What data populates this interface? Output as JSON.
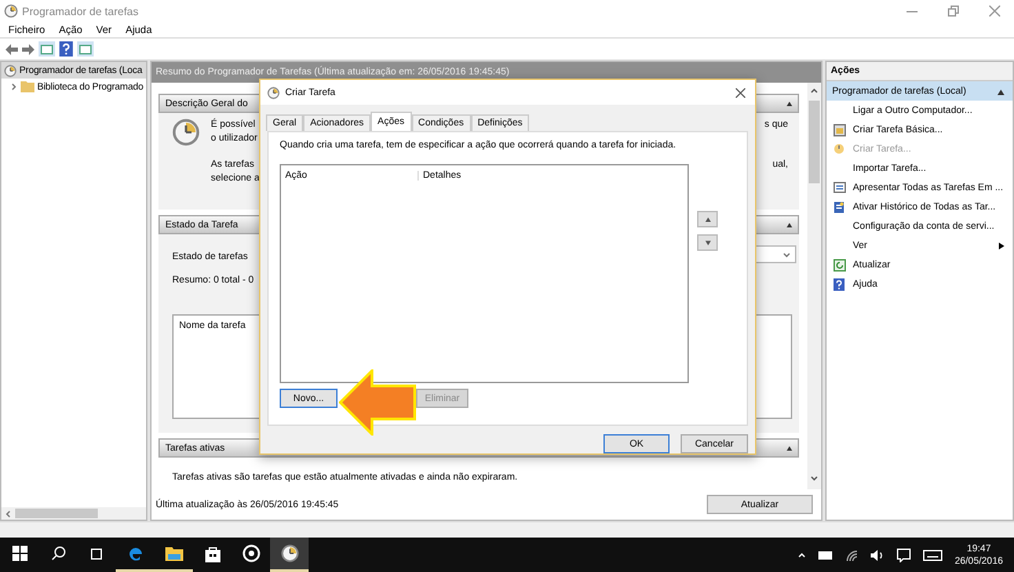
{
  "window": {
    "title": "Programador de tarefas"
  },
  "menu": [
    "Ficheiro",
    "Ação",
    "Ver",
    "Ajuda"
  ],
  "tree": [
    {
      "label": "Programador de tarefas (Loca",
      "selected": true,
      "expanded": true,
      "children": [
        {
          "label": "Biblioteca do Programado",
          "selected": false,
          "expanded": false
        }
      ]
    }
  ],
  "center": {
    "header": "Resumo do Programador de Tarefas (Última atualização em: 26/05/2016 19:45:45)",
    "overview": {
      "title": "Descrição Geral do",
      "lines": [
        "É possível",
        "o utilizador"
      ],
      "lines_2": [
        "As tarefas",
        "selecione a"
      ],
      "right_1": "s que",
      "right_2": "ual,"
    },
    "status": {
      "title": "Estado da Tarefa",
      "line_1": "Estado de tarefas",
      "line_2": "Resumo: 0 total - 0",
      "column": "Nome da tarefa"
    },
    "active": {
      "title": "Tarefas ativas",
      "description": "Tarefas ativas são tarefas que estão atualmente ativadas e ainda não expiraram."
    },
    "updated": "Última atualização às 26/05/2016 19:45:45",
    "refresh_button": "Atualizar"
  },
  "dialog": {
    "title": "Criar Tarefa",
    "tabs": [
      {
        "label": "Geral",
        "selected": false
      },
      {
        "label": "Acionadores",
        "selected": false
      },
      {
        "label": "Ações",
        "selected": true
      },
      {
        "label": "Condições",
        "selected": false
      },
      {
        "label": "Definições",
        "selected": false
      }
    ],
    "instruction": "Quando cria uma tarefa, tem de especificar a ação que ocorrerá quando a tarefa for iniciada.",
    "columns": [
      "Ação",
      "Detalhes"
    ],
    "buttons": [
      {
        "label": "Novo...",
        "disabled": false
      },
      {
        "label": "Eliminar",
        "disabled": true
      }
    ],
    "ok": "OK",
    "cancel": "Cancelar"
  },
  "actions": {
    "title": "Ações",
    "group": {
      "label": "Programador de tarefas (Local)",
      "expanded": true
    },
    "items": [
      {
        "label": "Ligar a Outro Computador...",
        "kind": "none",
        "disabled": false
      },
      {
        "label": "Criar Tarefa Básica...",
        "kind": "wizard",
        "disabled": false
      },
      {
        "label": "Criar Tarefa...",
        "kind": "task",
        "disabled": true
      },
      {
        "label": "Importar Tarefa...",
        "kind": "none",
        "disabled": false
      },
      {
        "label": "Apresentar Todas as Tarefas Em ...",
        "kind": "list",
        "disabled": false
      },
      {
        "label": "Ativar Histórico de Todas as Tar...",
        "kind": "history",
        "disabled": false
      },
      {
        "label": "Configuração da conta de servi...",
        "kind": "none",
        "disabled": false
      },
      {
        "label": "Ver",
        "kind": "submenu",
        "disabled": false
      },
      {
        "label": "Atualizar",
        "kind": "refresh",
        "disabled": false
      },
      {
        "label": "Ajuda",
        "kind": "help",
        "disabled": false
      }
    ]
  },
  "taskbar": {
    "apps": [
      {
        "kind": "edge",
        "open": true
      },
      {
        "kind": "explorer",
        "open": true
      },
      {
        "kind": "store",
        "open": false
      },
      {
        "kind": "media",
        "open": false
      },
      {
        "kind": "scheduler",
        "open": true
      }
    ],
    "time": "19:47",
    "date": "26/05/2016"
  }
}
